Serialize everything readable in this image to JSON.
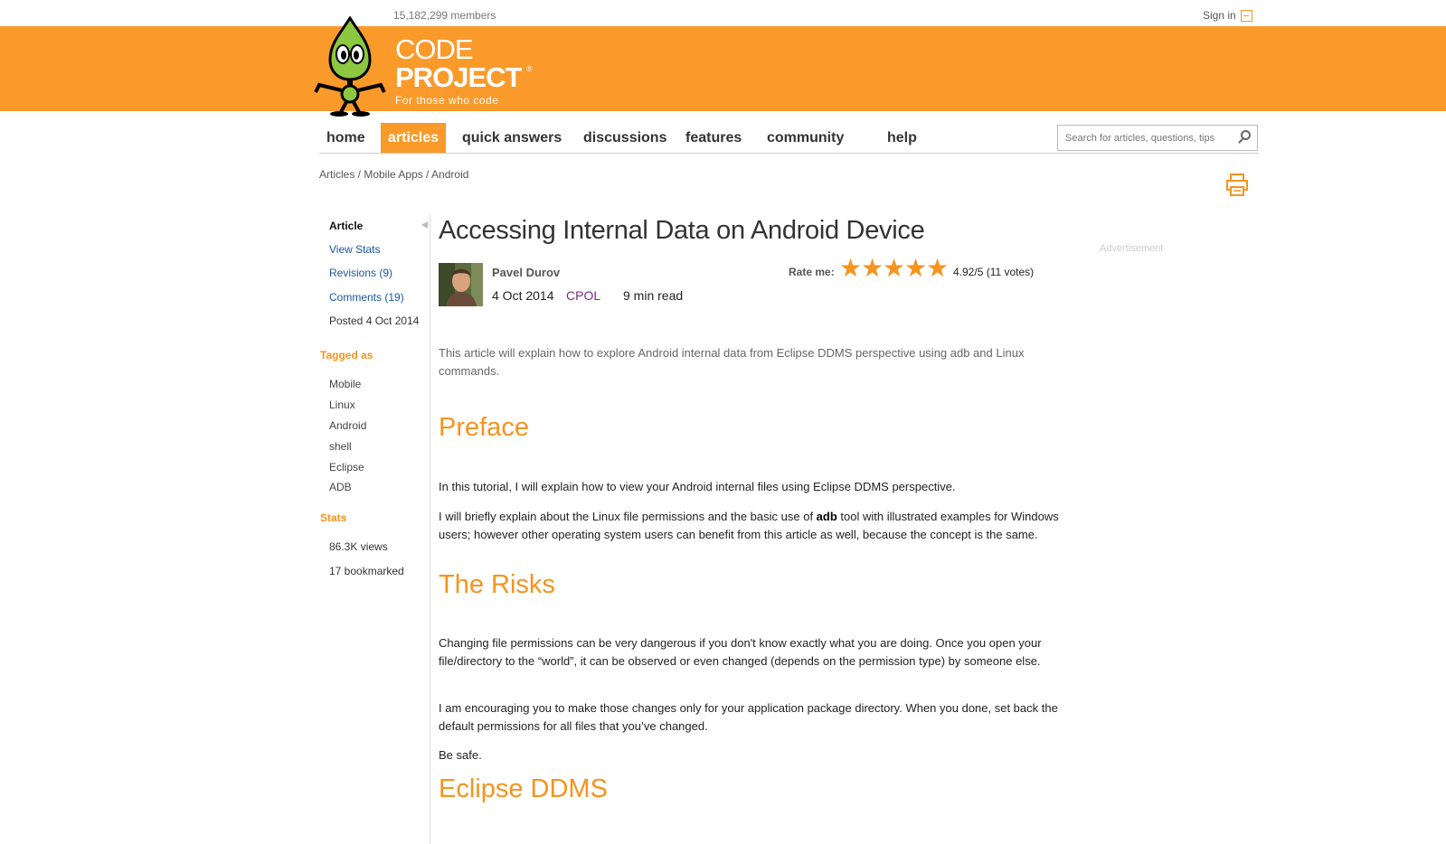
{
  "header": {
    "members": "15,182,299 members",
    "sign_in": "Sign in",
    "logo_line1": "CODE",
    "logo_line2": "PROJECT",
    "logo_reg": "®",
    "tagline": "For those who code"
  },
  "nav": {
    "items": [
      "home",
      "articles",
      "quick answers",
      "discussions",
      "features",
      "community",
      "help"
    ],
    "active": "articles",
    "search_placeholder": "Search for articles, questions, tips"
  },
  "breadcrumb": "Articles / Mobile Apps / Android",
  "sidebar": {
    "article": "Article",
    "view_stats": "View Stats",
    "revisions": "Revisions (9)",
    "comments": "Comments (19)",
    "posted": "Posted 4 Oct 2014",
    "tagged_as": "Tagged as",
    "tags": [
      "Mobile",
      "Linux",
      "Android",
      "shell",
      "Eclipse",
      "ADB"
    ],
    "stats_heading": "Stats",
    "views": "86.3K views",
    "bookmarked": "17 bookmarked"
  },
  "article": {
    "title": "Accessing Internal Data on Android Device",
    "author": "Pavel Durov",
    "date": "4 Oct 2014",
    "license": "CPOL",
    "read_time": "9 min read",
    "rate_label": "Rate me:",
    "rating_stars": 5,
    "rating_text": "4.92/5 (11 votes)",
    "advertisement": "Advertisement",
    "summary": "This article will explain how to explore Android internal data from Eclipse DDMS perspective using adb and Linux commands.",
    "preface_heading": "Preface",
    "preface_p1": "In this tutorial, I will explain how to view your Android internal files using Eclipse DDMS perspective.",
    "preface_p2_a": "I will briefly explain about the Linux file permissions and the basic use of ",
    "preface_p2_bold": "adb",
    "preface_p2_b": " tool with illustrated examples for Windows users; however other operating system users can benefit from this article as well, because the concept is the same.",
    "risks_heading": "The Risks",
    "risks_p1": "Changing file permissions can be very dangerous if you don't know exactly what you are doing. Once you open your file/directory to the “world”, it can be observed or even changed (depends on the permission type) by someone else.",
    "risks_p2": "I am encouraging you to make those changes only for your application package directory. When you done, set back the default permissions for all files that you’ve changed.",
    "risks_p3": "Be safe.",
    "ddms_heading": "Eclipse DDMS"
  },
  "colors": {
    "brand_orange": "#fa9a2b",
    "link_blue": "#1a56a6",
    "license_purple": "#7a2a8a"
  }
}
